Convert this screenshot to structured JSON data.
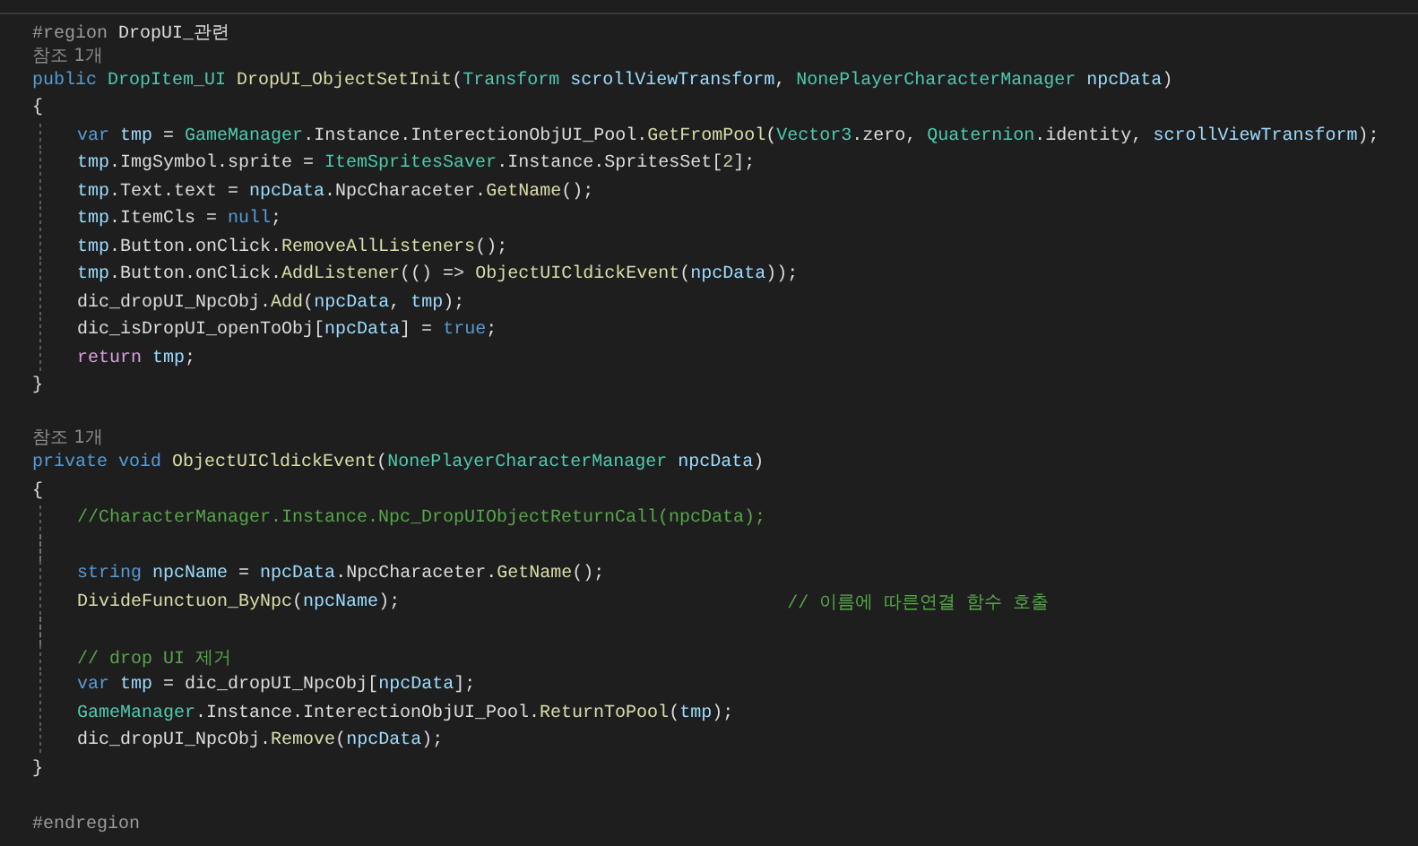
{
  "editor": {
    "lines": [
      {
        "kind": "code",
        "indented": false,
        "tokens": [
          {
            "kind": "pp",
            "t": "#region "
          },
          {
            "kind": "pl",
            "t": "DropUI_관련"
          }
        ]
      },
      {
        "kind": "codelens",
        "text": "참조 1개"
      },
      {
        "kind": "code",
        "indented": false,
        "tokens": [
          {
            "kind": "kw",
            "t": "public "
          },
          {
            "kind": "ty",
            "t": "DropItem_UI "
          },
          {
            "kind": "fn",
            "t": "DropUI_ObjectSetInit"
          },
          {
            "kind": "pl",
            "t": "("
          },
          {
            "kind": "ty",
            "t": "Transform "
          },
          {
            "kind": "va",
            "t": "scrollViewTransform"
          },
          {
            "kind": "pl",
            "t": ", "
          },
          {
            "kind": "ty",
            "t": "NonePlayerCharacterManager "
          },
          {
            "kind": "va",
            "t": "npcData"
          },
          {
            "kind": "pl",
            "t": ")"
          }
        ]
      },
      {
        "kind": "code",
        "indented": false,
        "tokens": [
          {
            "kind": "pl",
            "t": "{"
          }
        ]
      },
      {
        "kind": "code",
        "indented": true,
        "tokens": [
          {
            "kind": "kw",
            "t": "var "
          },
          {
            "kind": "va",
            "t": "tmp"
          },
          {
            "kind": "pl",
            "t": " = "
          },
          {
            "kind": "ty",
            "t": "GameManager"
          },
          {
            "kind": "pl",
            "t": ".Instance.InterectionObjUI_Pool."
          },
          {
            "kind": "fn",
            "t": "GetFromPool"
          },
          {
            "kind": "pl",
            "t": "("
          },
          {
            "kind": "ty",
            "t": "Vector3"
          },
          {
            "kind": "pl",
            "t": ".zero, "
          },
          {
            "kind": "ty",
            "t": "Quaternion"
          },
          {
            "kind": "pl",
            "t": ".identity, "
          },
          {
            "kind": "va",
            "t": "scrollViewTransform"
          },
          {
            "kind": "pl",
            "t": ");"
          }
        ]
      },
      {
        "kind": "code",
        "indented": true,
        "tokens": [
          {
            "kind": "va",
            "t": "tmp"
          },
          {
            "kind": "pl",
            "t": ".ImgSymbol.sprite = "
          },
          {
            "kind": "ty",
            "t": "ItemSpritesSaver"
          },
          {
            "kind": "pl",
            "t": ".Instance.SpritesSet["
          },
          {
            "kind": "nu",
            "t": "2"
          },
          {
            "kind": "pl",
            "t": "];"
          }
        ]
      },
      {
        "kind": "code",
        "indented": true,
        "tokens": [
          {
            "kind": "va",
            "t": "tmp"
          },
          {
            "kind": "pl",
            "t": ".Text.text = "
          },
          {
            "kind": "va",
            "t": "npcData"
          },
          {
            "kind": "pl",
            "t": ".NpcCharaceter."
          },
          {
            "kind": "fn",
            "t": "GetName"
          },
          {
            "kind": "pl",
            "t": "();"
          }
        ]
      },
      {
        "kind": "code",
        "indented": true,
        "tokens": [
          {
            "kind": "va",
            "t": "tmp"
          },
          {
            "kind": "pl",
            "t": ".ItemCls = "
          },
          {
            "kind": "kw",
            "t": "null"
          },
          {
            "kind": "pl",
            "t": ";"
          }
        ]
      },
      {
        "kind": "code",
        "indented": true,
        "tokens": [
          {
            "kind": "va",
            "t": "tmp"
          },
          {
            "kind": "pl",
            "t": ".Button.onClick."
          },
          {
            "kind": "fn",
            "t": "RemoveAllListeners"
          },
          {
            "kind": "pl",
            "t": "();"
          }
        ]
      },
      {
        "kind": "code",
        "indented": true,
        "tokens": [
          {
            "kind": "va",
            "t": "tmp"
          },
          {
            "kind": "pl",
            "t": ".Button.onClick."
          },
          {
            "kind": "fn",
            "t": "AddListener"
          },
          {
            "kind": "pl",
            "t": "(() => "
          },
          {
            "kind": "fn",
            "t": "ObjectUICldickEvent"
          },
          {
            "kind": "pl",
            "t": "("
          },
          {
            "kind": "va",
            "t": "npcData"
          },
          {
            "kind": "pl",
            "t": "));"
          }
        ]
      },
      {
        "kind": "code",
        "indented": true,
        "tokens": [
          {
            "kind": "pl",
            "t": "dic_dropUI_NpcObj."
          },
          {
            "kind": "fn",
            "t": "Add"
          },
          {
            "kind": "pl",
            "t": "("
          },
          {
            "kind": "va",
            "t": "npcData"
          },
          {
            "kind": "pl",
            "t": ", "
          },
          {
            "kind": "va",
            "t": "tmp"
          },
          {
            "kind": "pl",
            "t": ");"
          }
        ]
      },
      {
        "kind": "code",
        "indented": true,
        "tokens": [
          {
            "kind": "pl",
            "t": "dic_isDropUI_openToObj["
          },
          {
            "kind": "va",
            "t": "npcData"
          },
          {
            "kind": "pl",
            "t": "] = "
          },
          {
            "kind": "kw",
            "t": "true"
          },
          {
            "kind": "pl",
            "t": ";"
          }
        ]
      },
      {
        "kind": "code",
        "indented": true,
        "tokens": [
          {
            "kind": "ctl",
            "t": "return "
          },
          {
            "kind": "va",
            "t": "tmp"
          },
          {
            "kind": "pl",
            "t": ";"
          }
        ]
      },
      {
        "kind": "code",
        "indented": false,
        "tokens": [
          {
            "kind": "pl",
            "t": "}"
          }
        ]
      },
      {
        "kind": "blank",
        "indented": false
      },
      {
        "kind": "codelens",
        "text": "참조 1개"
      },
      {
        "kind": "code",
        "indented": false,
        "tokens": [
          {
            "kind": "kw",
            "t": "private void "
          },
          {
            "kind": "fn",
            "t": "ObjectUICldickEvent"
          },
          {
            "kind": "pl",
            "t": "("
          },
          {
            "kind": "ty",
            "t": "NonePlayerCharacterManager "
          },
          {
            "kind": "va",
            "t": "npcData"
          },
          {
            "kind": "pl",
            "t": ")"
          }
        ]
      },
      {
        "kind": "code",
        "indented": false,
        "tokens": [
          {
            "kind": "pl",
            "t": "{"
          }
        ]
      },
      {
        "kind": "code",
        "indented": true,
        "tokens": [
          {
            "kind": "cm",
            "t": "//CharacterManager.Instance.Npc_DropUIObjectReturnCall(npcData);"
          }
        ]
      },
      {
        "kind": "blank",
        "indented": true
      },
      {
        "kind": "code",
        "indented": true,
        "tokens": [
          {
            "kind": "kw",
            "t": "string "
          },
          {
            "kind": "va",
            "t": "npcName"
          },
          {
            "kind": "pl",
            "t": " = "
          },
          {
            "kind": "va",
            "t": "npcData"
          },
          {
            "kind": "pl",
            "t": ".NpcCharaceter."
          },
          {
            "kind": "fn",
            "t": "GetName"
          },
          {
            "kind": "pl",
            "t": "();"
          }
        ]
      },
      {
        "kind": "code",
        "indented": true,
        "tokens": [
          {
            "kind": "fn",
            "t": "DivideFunctuon_ByNpc"
          },
          {
            "kind": "pl",
            "t": "("
          },
          {
            "kind": "va",
            "t": "npcName"
          },
          {
            "kind": "pl",
            "t": ");"
          }
        ],
        "trailing_comment": "// 이름에 따른연결 함수 호출"
      },
      {
        "kind": "blank",
        "indented": true
      },
      {
        "kind": "code",
        "indented": true,
        "tokens": [
          {
            "kind": "cm",
            "t": "// drop UI 제거"
          }
        ]
      },
      {
        "kind": "code",
        "indented": true,
        "tokens": [
          {
            "kind": "kw",
            "t": "var "
          },
          {
            "kind": "va",
            "t": "tmp"
          },
          {
            "kind": "pl",
            "t": " = dic_dropUI_NpcObj["
          },
          {
            "kind": "va",
            "t": "npcData"
          },
          {
            "kind": "pl",
            "t": "];"
          }
        ]
      },
      {
        "kind": "code",
        "indented": true,
        "tokens": [
          {
            "kind": "ty",
            "t": "GameManager"
          },
          {
            "kind": "pl",
            "t": ".Instance.InterectionObjUI_Pool."
          },
          {
            "kind": "fn",
            "t": "ReturnToPool"
          },
          {
            "kind": "pl",
            "t": "("
          },
          {
            "kind": "va",
            "t": "tmp"
          },
          {
            "kind": "pl",
            "t": ");"
          }
        ]
      },
      {
        "kind": "code",
        "indented": true,
        "tokens": [
          {
            "kind": "pl",
            "t": "dic_dropUI_NpcObj."
          },
          {
            "kind": "fn",
            "t": "Remove"
          },
          {
            "kind": "pl",
            "t": "("
          },
          {
            "kind": "va",
            "t": "npcData"
          },
          {
            "kind": "pl",
            "t": ");"
          }
        ]
      },
      {
        "kind": "code",
        "indented": false,
        "tokens": [
          {
            "kind": "pl",
            "t": "}"
          }
        ]
      },
      {
        "kind": "blank",
        "indented": false
      },
      {
        "kind": "code",
        "indented": false,
        "tokens": [
          {
            "kind": "pp",
            "t": "#endregion"
          }
        ]
      }
    ]
  }
}
